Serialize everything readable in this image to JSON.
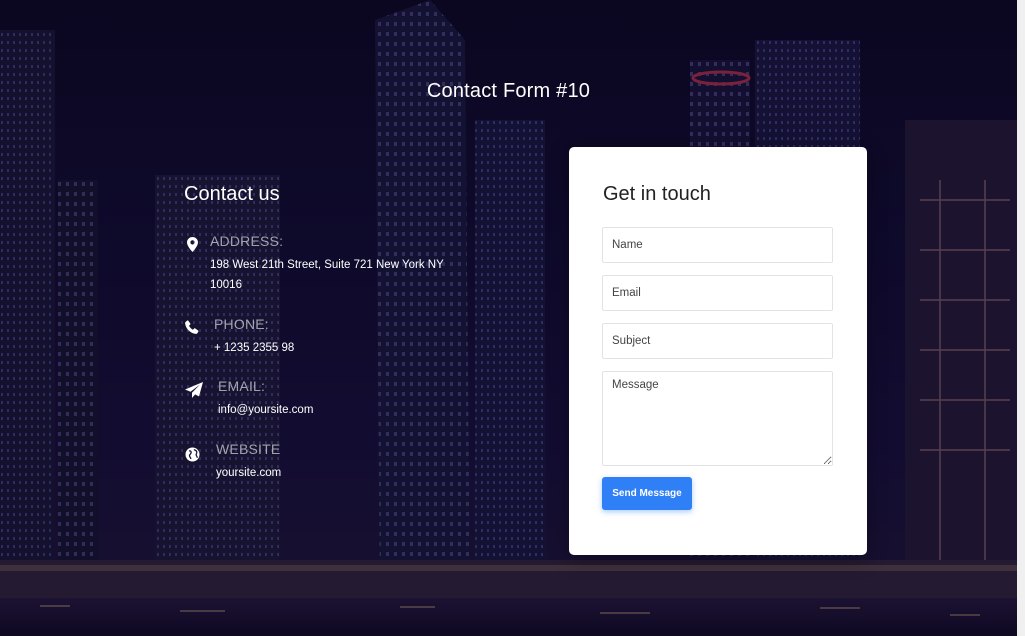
{
  "page": {
    "title": "Contact Form #10"
  },
  "contact": {
    "heading": "Contact us",
    "items": [
      {
        "label": "ADDRESS:",
        "value": "198 West 21th Street, Suite 721 New York NY 10016",
        "icon": "map-marker-icon"
      },
      {
        "label": "PHONE:",
        "value": "+ 1235 2355 98",
        "icon": "phone-icon"
      },
      {
        "label": "EMAIL:",
        "value": "info@yoursite.com",
        "icon": "paper-plane-icon"
      },
      {
        "label": "WEBSITE",
        "value": "yoursite.com",
        "icon": "globe-icon"
      }
    ]
  },
  "form": {
    "title": "Get in touch",
    "name_placeholder": "Name",
    "email_placeholder": "Email",
    "subject_placeholder": "Subject",
    "message_placeholder": "Message",
    "submit_label": "Send Message"
  },
  "colors": {
    "accent": "#2f7ff7",
    "card_bg": "#ffffff",
    "text_light": "#ffffff"
  }
}
